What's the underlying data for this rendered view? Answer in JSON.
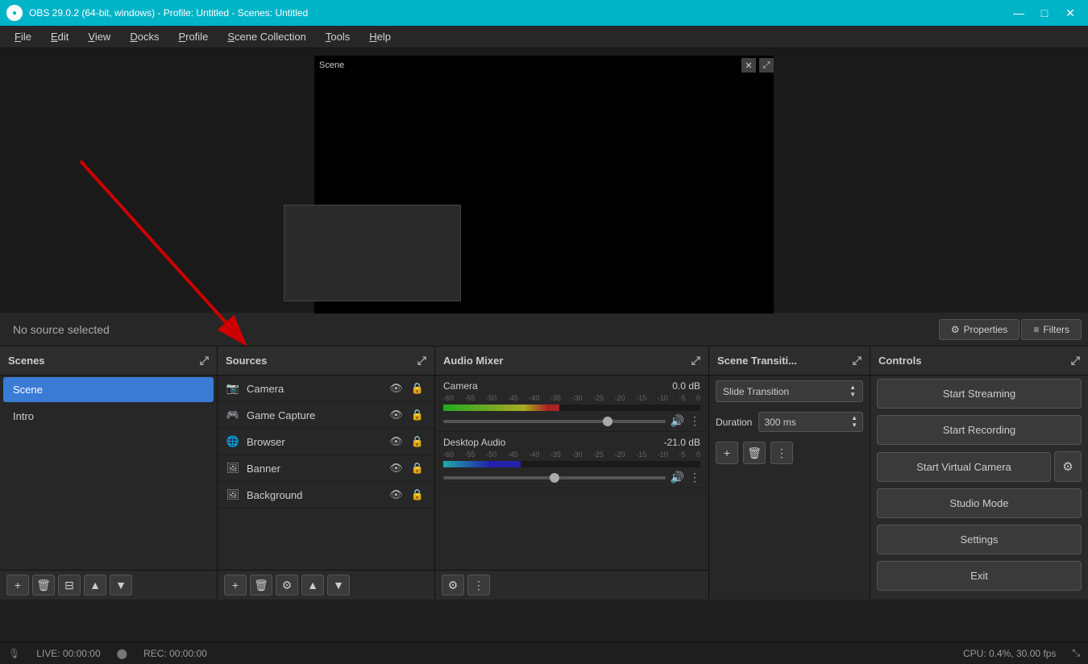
{
  "window": {
    "title": "OBS 29.0.2 (64-bit, windows) - Profile: Untitled - Scenes: Untitled",
    "icon": "OBS"
  },
  "titlebar_controls": {
    "minimize": "—",
    "maximize": "□",
    "close": "✕"
  },
  "menubar": {
    "items": [
      {
        "id": "file",
        "label": "File",
        "underline_index": 0
      },
      {
        "id": "edit",
        "label": "Edit",
        "underline_index": 0
      },
      {
        "id": "view",
        "label": "View",
        "underline_index": 0
      },
      {
        "id": "docks",
        "label": "Docks",
        "underline_index": 0
      },
      {
        "id": "profile",
        "label": "Profile",
        "underline_index": 0
      },
      {
        "id": "scene_collection",
        "label": "Scene Collection",
        "underline_index": 0
      },
      {
        "id": "tools",
        "label": "Tools",
        "underline_index": 0
      },
      {
        "id": "help",
        "label": "Help",
        "underline_index": 0
      }
    ]
  },
  "preview": {
    "scene_label": "Scene",
    "close_btn": "✕",
    "search_btn": "🔍"
  },
  "propbar": {
    "no_source_label": "No source selected",
    "properties_btn": "Properties",
    "filters_btn": "Filters"
  },
  "scenes": {
    "header": "Scenes",
    "items": [
      {
        "name": "Scene",
        "active": true
      },
      {
        "name": "Intro",
        "active": false
      }
    ],
    "footer_btns": [
      "add",
      "remove",
      "configure",
      "up",
      "down"
    ]
  },
  "sources": {
    "header": "Sources",
    "items": [
      {
        "name": "Camera",
        "icon": "camera"
      },
      {
        "name": "Game Capture",
        "icon": "gamepad"
      },
      {
        "name": "Browser",
        "icon": "browser"
      },
      {
        "name": "Banner",
        "icon": "image"
      },
      {
        "name": "Background",
        "icon": "image"
      }
    ],
    "footer_btns": [
      "add",
      "remove",
      "settings",
      "up",
      "down"
    ]
  },
  "audio_mixer": {
    "header": "Audio Mixer",
    "channels": [
      {
        "name": "Camera",
        "db": "0.0 dB",
        "meter_width_pct": 45,
        "volume_pct": 75,
        "labels": [
          "-60",
          "-55",
          "-50",
          "-45",
          "-40",
          "-35",
          "-30",
          "-25",
          "-20",
          "-15",
          "-10",
          "-5",
          "0"
        ]
      },
      {
        "name": "Desktop Audio",
        "db": "-21.0 dB",
        "meter_width_pct": 30,
        "volume_pct": 50,
        "labels": [
          "-60",
          "-55",
          "-50",
          "-45",
          "-40",
          "-35",
          "-30",
          "-25",
          "-20",
          "-15",
          "-10",
          "-5",
          "0"
        ]
      }
    ],
    "footer_btns": [
      "gear",
      "more"
    ]
  },
  "scene_transition": {
    "header": "Scene Transiti...",
    "selected": "Slide Transition",
    "duration_label": "Duration",
    "duration_value": "300 ms",
    "footer_btns": [
      "add",
      "remove",
      "more"
    ]
  },
  "controls": {
    "header": "Controls",
    "start_streaming": "Start Streaming",
    "start_recording": "Start Recording",
    "start_virtual_camera": "Start Virtual Camera",
    "studio_mode": "Studio Mode",
    "settings": "Settings",
    "exit": "Exit"
  },
  "statusbar": {
    "live_label": "LIVE: 00:00:00",
    "rec_label": "REC: 00:00:00",
    "cpu_label": "CPU: 0.4%, 30.00 fps",
    "resize_handle": "⤡"
  }
}
